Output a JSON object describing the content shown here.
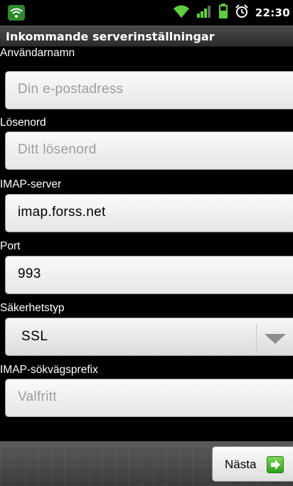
{
  "status_bar": {
    "time": "22:30",
    "icons": [
      "wifi-left-icon",
      "wifi-icon",
      "signal-icon",
      "battery-icon",
      "alarm-icon"
    ]
  },
  "title": "Inkommande serverinställningar",
  "fields": {
    "username": {
      "label": "Användarnamn",
      "placeholder": "Din e-postadress",
      "value": ""
    },
    "password": {
      "label": "Lösenord",
      "placeholder": "Ditt lösenord",
      "value": ""
    },
    "imap_server": {
      "label": "IMAP-server",
      "value": "imap.forss.net"
    },
    "port": {
      "label": "Port",
      "value": "993"
    },
    "security_type": {
      "label": "Säkerhetstyp",
      "value": "SSL"
    },
    "imap_path_prefix": {
      "label": "IMAP-sökvägsprefix",
      "placeholder": "Valfritt",
      "value": ""
    }
  },
  "buttons": {
    "next_label": "Nästa"
  },
  "colors": {
    "accent_green": "#3fae2a",
    "background": "#000000",
    "titlebar": "#3a3a3a"
  }
}
